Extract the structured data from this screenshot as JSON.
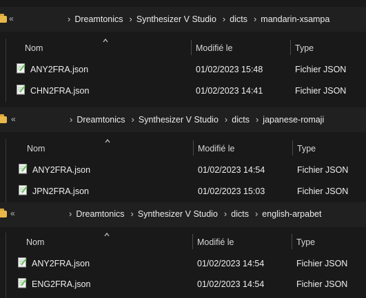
{
  "columns": {
    "name": "Nom",
    "modified": "Modifié le",
    "type": "Type"
  },
  "panels": [
    {
      "breadcrumb": [
        "Dreamtonics",
        "Synthesizer V Studio",
        "dicts",
        "mandarin-xsampa"
      ],
      "files": [
        {
          "name": "ANY2FRA.json",
          "modified": "01/02/2023 15:48",
          "type": "Fichier JSON"
        },
        {
          "name": "CHN2FRA.json",
          "modified": "01/02/2023 14:41",
          "type": "Fichier JSON"
        }
      ]
    },
    {
      "breadcrumb": [
        "Dreamtonics",
        "Synthesizer V Studio",
        "dicts",
        "japanese-romaji"
      ],
      "files": [
        {
          "name": "ANY2FRA.json",
          "modified": "01/02/2023 14:54",
          "type": "Fichier JSON"
        },
        {
          "name": "JPN2FRA.json",
          "modified": "01/02/2023 15:03",
          "type": "Fichier JSON"
        }
      ]
    },
    {
      "breadcrumb": [
        "Dreamtonics",
        "Synthesizer V Studio",
        "dicts",
        "english-arpabet"
      ],
      "files": [
        {
          "name": "ANY2FRA.json",
          "modified": "01/02/2023 14:54",
          "type": "Fichier JSON"
        },
        {
          "name": "ENG2FRA.json",
          "modified": "01/02/2023 14:54",
          "type": "Fichier JSON"
        }
      ]
    }
  ],
  "icons": {
    "folder": "folder-icon",
    "overflow": "double-chevron-left-icon",
    "separator": "chevron-right-icon",
    "sort": "sort-up-icon",
    "file": "json-file-icon"
  },
  "colors": {
    "background": "#191919",
    "address_bar": "#202020",
    "folder": "#e9b84a",
    "text": "#efefef"
  }
}
